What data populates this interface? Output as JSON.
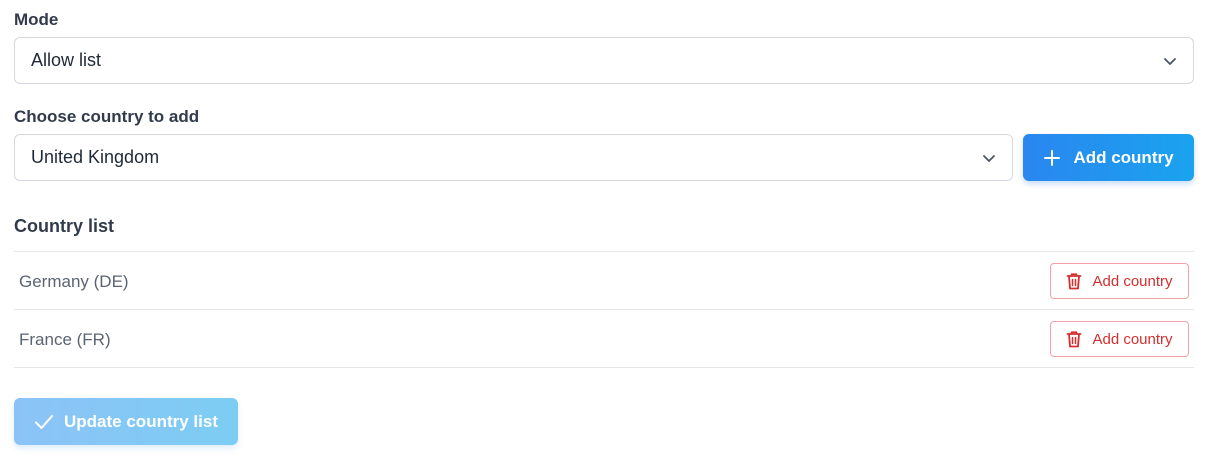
{
  "mode": {
    "label": "Mode",
    "selected": "Allow list"
  },
  "country_picker": {
    "label": "Choose country to add",
    "selected": "United Kingdom",
    "add_button_label": "Add country"
  },
  "country_list": {
    "title": "Country list",
    "items": [
      {
        "name": "Germany (DE)",
        "remove_label": "Add country"
      },
      {
        "name": "France (FR)",
        "remove_label": "Add country"
      }
    ]
  },
  "update_button_label": "Update country list",
  "colors": {
    "primary": "#2a86f0",
    "danger": "#d32f2f",
    "disabled_primary": "#8cc3f6"
  },
  "icons": {
    "select_arrow": "chevron-down-icon",
    "add": "plus-icon",
    "remove": "trash-icon",
    "confirm": "check-icon"
  }
}
